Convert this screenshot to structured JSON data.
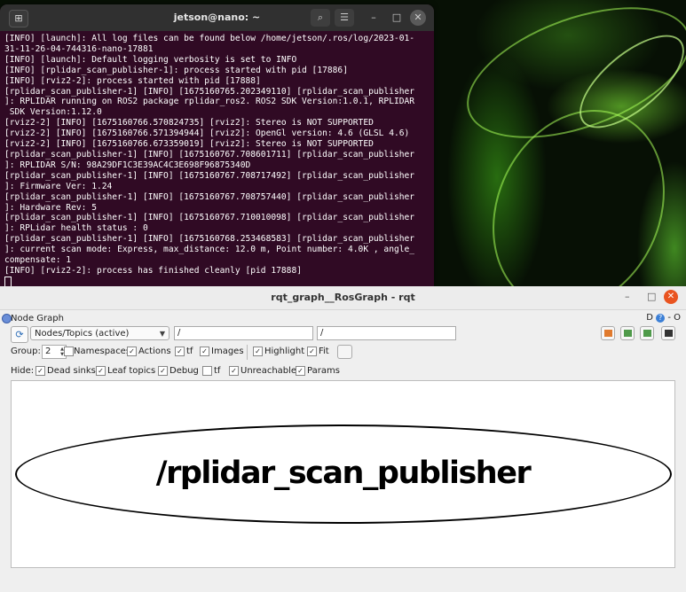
{
  "terminal": {
    "title": "jetson@nano: ~",
    "lines": [
      "[INFO] [launch]: All log files can be found below /home/jetson/.ros/log/2023-01-",
      "31-11-26-04-744316-nano-17881",
      "[INFO] [launch]: Default logging verbosity is set to INFO",
      "[INFO] [rplidar_scan_publisher-1]: process started with pid [17886]",
      "[INFO] [rviz2-2]: process started with pid [17888]",
      "[rplidar_scan_publisher-1] [INFO] [1675160765.202349110] [rplidar_scan_publisher",
      "]: RPLIDAR running on ROS2 package rplidar_ros2. ROS2 SDK Version:1.0.1, RPLIDAR",
      " SDK Version:1.12.0",
      "[rviz2-2] [INFO] [1675160766.570824735] [rviz2]: Stereo is NOT SUPPORTED",
      "[rviz2-2] [INFO] [1675160766.571394944] [rviz2]: OpenGl version: 4.6 (GLSL 4.6)",
      "[rviz2-2] [INFO] [1675160766.673359019] [rviz2]: Stereo is NOT SUPPORTED",
      "[rplidar_scan_publisher-1] [INFO] [1675160767.708601711] [rplidar_scan_publisher",
      "]: RPLIDAR S/N: 98A29DF1C3E39AC4C3E698F96875340D",
      "[rplidar_scan_publisher-1] [INFO] [1675160767.708717492] [rplidar_scan_publisher",
      "]: Firmware Ver: 1.24",
      "[rplidar_scan_publisher-1] [INFO] [1675160767.708757440] [rplidar_scan_publisher",
      "]: Hardware Rev: 5",
      "[rplidar_scan_publisher-1] [INFO] [1675160767.710010098] [rplidar_scan_publisher",
      "]: RPLidar health status : 0",
      "[rplidar_scan_publisher-1] [INFO] [1675160768.253468583] [rplidar_scan_publisher",
      "]: current scan mode: Express, max_distance: 12.0 m, Point number: 4.0K , angle_",
      "compensate: 1",
      "[INFO] [rviz2-2]: process has finished cleanly [pid 17888]"
    ],
    "colors": {
      "background": "#300a24",
      "titlebar": "#303030"
    }
  },
  "rqt": {
    "title": "rqt_graph__RosGraph - rqt",
    "plugin_title": "Node Graph",
    "plugin_right": "D",
    "plugin_right_extra": "- O",
    "view_mode": "Nodes/Topics (active)",
    "node_filter": "/",
    "topic_filter": "/",
    "group_label": "Group:",
    "group_value": "2",
    "options": {
      "namespaces": "Namespaces",
      "actions": "Actions",
      "tf": "tf",
      "images": "Images",
      "highlight": "Highlight",
      "fit": "Fit"
    },
    "hide_label": "Hide:",
    "hide": {
      "dead_sinks": "Dead sinks",
      "leaf_topics": "Leaf topics",
      "debug": "Debug",
      "tf": "tf",
      "unreachable": "Unreachable",
      "params": "Params"
    },
    "checked": {
      "namespaces": false,
      "actions": true,
      "tf": true,
      "images": true,
      "highlight": true,
      "fit": true,
      "dead_sinks": true,
      "leaf_topics": true,
      "debug": true,
      "hide_tf": false,
      "unreachable": true,
      "params": true
    },
    "node_name": "/rplidar_scan_publisher",
    "colors": {
      "close": "#e95420",
      "accent": "#2f6fb8"
    }
  }
}
